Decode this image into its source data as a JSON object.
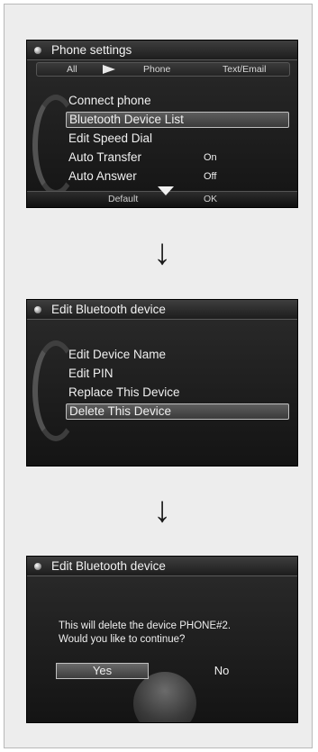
{
  "screen1": {
    "title": "Phone settings",
    "tabs": [
      "All",
      "Phone",
      "Text/Email"
    ],
    "items": [
      {
        "label": "Connect phone",
        "value": ""
      },
      {
        "label": "Bluetooth Device List",
        "value": "",
        "selected": true
      },
      {
        "label": "Edit Speed Dial",
        "value": ""
      },
      {
        "label": "Auto Transfer",
        "value": "On"
      },
      {
        "label": "Auto Answer",
        "value": "Off"
      }
    ],
    "bottom": {
      "default_label": "Default",
      "ok_label": "OK"
    }
  },
  "arrow_glyph": "↓",
  "screen2": {
    "title": "Edit Bluetooth device",
    "items": [
      {
        "label": "Edit Device Name"
      },
      {
        "label": "Edit PIN"
      },
      {
        "label": "Replace This Device"
      },
      {
        "label": "Delete This Device",
        "selected": true
      }
    ]
  },
  "screen3": {
    "title": "Edit Bluetooth device",
    "message_line1": "This will delete the device PHONE#2.",
    "message_line2": "Would you like to continue?",
    "yes_label": "Yes",
    "no_label": "No"
  },
  "icons": {
    "title_dot": "dot-icon",
    "more_down": "triangle-down-icon",
    "tab_pointer": "triangle-right-icon",
    "flow_arrow": "arrow-down-icon"
  }
}
